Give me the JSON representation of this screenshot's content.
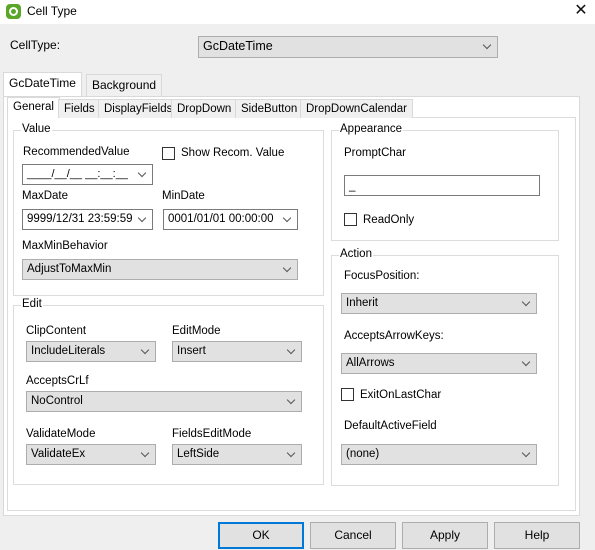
{
  "window": {
    "title": "Cell Type",
    "app_icon": "spread-logo-icon",
    "close_icon": "close-icon",
    "close_glyph": "✕"
  },
  "celltype": {
    "label": "CellType:",
    "value": "GcDateTime"
  },
  "outer_tabs": [
    {
      "label": "GcDateTime",
      "active": true
    },
    {
      "label": "Background",
      "active": false
    }
  ],
  "inner_tabs": [
    {
      "label": "General",
      "active": true
    },
    {
      "label": "Fields",
      "active": false
    },
    {
      "label": "DisplayFields",
      "active": false
    },
    {
      "label": "DropDown",
      "active": false
    },
    {
      "label": "SideButton",
      "active": false
    },
    {
      "label": "DropDownCalendar",
      "active": false
    }
  ],
  "value_group": {
    "title": "Value",
    "recommended_label": "RecommendedValue",
    "recommended_value": "____/__/__ __:__:__",
    "show_recom_label": "Show Recom. Value",
    "show_recom_checked": false,
    "maxdate_label": "MaxDate",
    "maxdate_value": "9999/12/31 23:59:59",
    "mindate_label": "MinDate",
    "mindate_value": "0001/01/01 00:00:00",
    "maxminbehavior_label": "MaxMinBehavior",
    "maxminbehavior_value": "AdjustToMaxMin"
  },
  "edit_group": {
    "title": "Edit",
    "clipcontent_label": "ClipContent",
    "clipcontent_value": "IncludeLiterals",
    "editmode_label": "EditMode",
    "editmode_value": "Insert",
    "acceptscrlf_label": "AcceptsCrLf",
    "acceptscrlf_value": "NoControl",
    "validatemode_label": "ValidateMode",
    "validatemode_value": "ValidateEx",
    "fieldseditmode_label": "FieldsEditMode",
    "fieldseditmode_value": "LeftSide"
  },
  "appearance_group": {
    "title": "Appearance",
    "promptchar_label": "PromptChar",
    "promptchar_value": "_",
    "readonly_label": "ReadOnly",
    "readonly_checked": false
  },
  "action_group": {
    "title": "Action",
    "focusposition_label": "FocusPosition:",
    "focusposition_value": "Inherit",
    "acceptsarrowkeys_label": "AcceptsArrowKeys:",
    "acceptsarrowkeys_value": "AllArrows",
    "exitonlastchar_label": "ExitOnLastChar",
    "exitonlastchar_checked": false,
    "defaultactivefield_label": "DefaultActiveField",
    "defaultactivefield_value": "(none)"
  },
  "buttons": {
    "ok": "OK",
    "cancel": "Cancel",
    "apply": "Apply",
    "help": "Help"
  },
  "colors": {
    "accent": "#0078d7",
    "logo": "#5aa629"
  }
}
